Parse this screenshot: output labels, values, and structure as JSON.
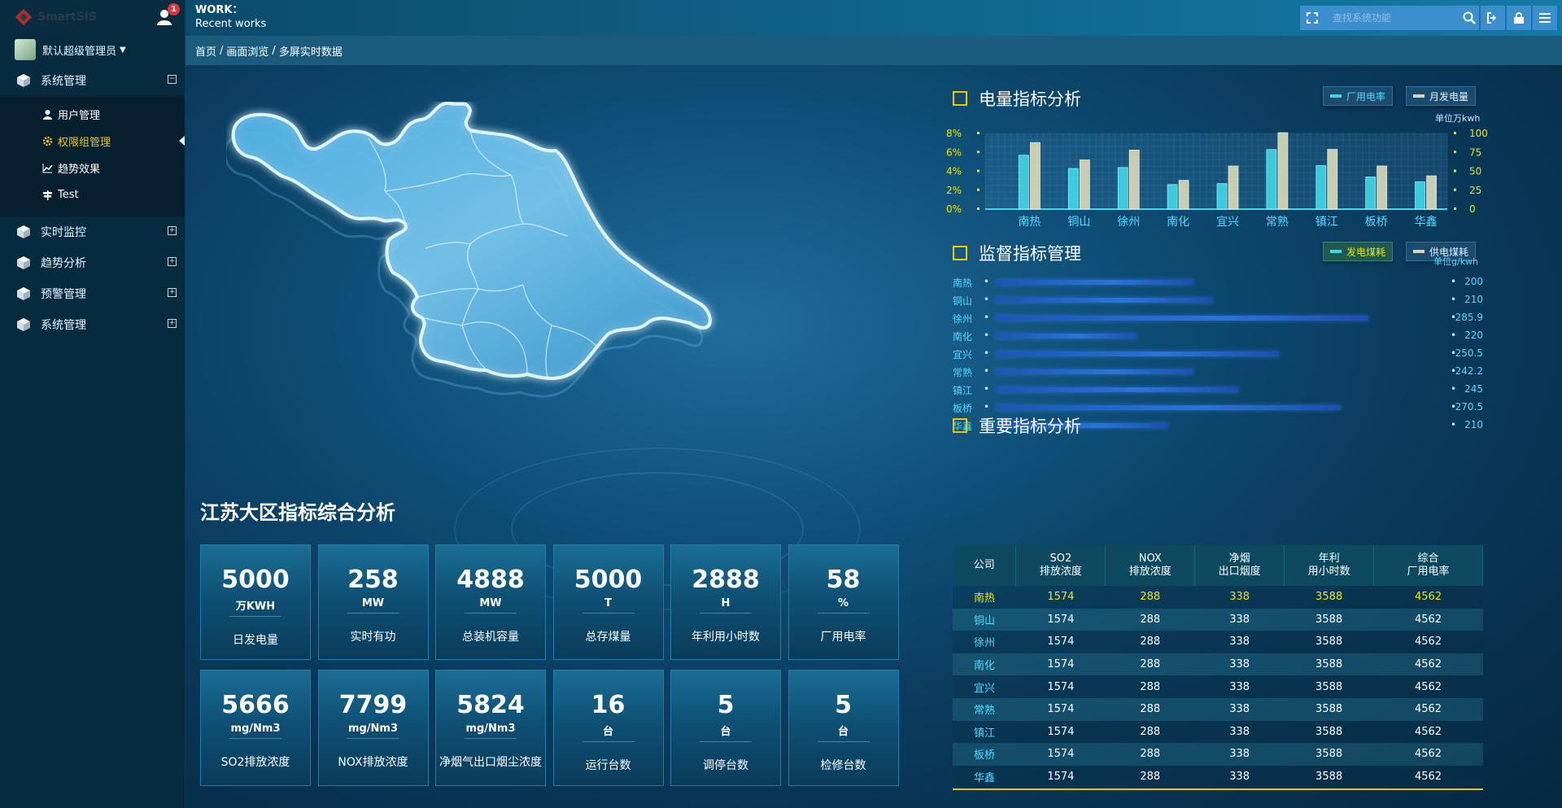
{
  "app": {
    "logo_text": "SmartSIS",
    "notif_count": "1",
    "user_name": "默认超级管理员"
  },
  "header": {
    "title": "WORK：",
    "subtitle": "Recent works",
    "search_placeholder": "查找系统功能"
  },
  "breadcrumb": [
    "首页",
    "画面浏览",
    "多屏实时数据"
  ],
  "sidebar": {
    "groups": [
      {
        "label": "系统管理",
        "expanded": true
      },
      {
        "label": "实时监控",
        "expanded": false
      },
      {
        "label": "趋势分析",
        "expanded": false
      },
      {
        "label": "预警管理",
        "expanded": false
      },
      {
        "label": "系统管理",
        "expanded": false
      }
    ],
    "subitems": [
      {
        "label": "用户管理",
        "icon": "user-icon"
      },
      {
        "label": "权限组管理",
        "icon": "gear-icon",
        "active": true
      },
      {
        "label": "趋势效果",
        "icon": "line-chart-icon"
      },
      {
        "label": "Test",
        "icon": "signpost-icon"
      }
    ]
  },
  "colors": {
    "accent_yellow": "#f2c400",
    "cyan": "#57d9ff",
    "bar_cyan": "#3fd8e8",
    "bar_beige": "#d8d8b8",
    "hbar_blue": "#2a6fd6"
  },
  "panel1": {
    "title": "电量指标分析",
    "legend": [
      "厂用电率",
      "月发电量"
    ],
    "unit": "单位万kwh",
    "chart_data": {
      "type": "bar",
      "categories": [
        "南热",
        "铜山",
        "徐州",
        "南化",
        "宜兴",
        "常熟",
        "镇江",
        "板桥",
        "华鑫"
      ],
      "series": [
        {
          "name": "厂用电率",
          "axis": "left",
          "values": [
            5.7,
            4.3,
            4.4,
            2.6,
            2.7,
            6.3,
            4.6,
            3.4,
            2.9
          ]
        },
        {
          "name": "月发电量",
          "axis": "right",
          "values": [
            88,
            65,
            78,
            38,
            57,
            101,
            79,
            57,
            44
          ]
        }
      ],
      "y_left": {
        "ticks": [
          "8%",
          "6%",
          "4%",
          "2%",
          "0%"
        ],
        "range": [
          0,
          8
        ]
      },
      "y_right": {
        "ticks": [
          "100",
          "75",
          "50",
          "25",
          "0"
        ],
        "range": [
          0,
          100
        ]
      }
    }
  },
  "panel2": {
    "title": "监督指标管理",
    "legend": [
      "发电煤耗",
      "供电煤耗"
    ],
    "unit": "单位g/kwh",
    "chart_data": {
      "type": "bar",
      "orientation": "horizontal",
      "categories": [
        "南热",
        "铜山",
        "徐州",
        "南化",
        "宜兴",
        "常熟",
        "镇江",
        "板桥",
        "华鑫"
      ],
      "values": [
        200,
        210,
        285.9,
        220,
        250.5,
        242.2,
        245,
        270.5,
        210
      ],
      "labels": [
        "200",
        "210",
        "285.9",
        "220",
        "250.5",
        "242.2",
        "245",
        "270.5",
        "210"
      ],
      "bar_fraction": [
        0.53,
        0.58,
        1.0,
        0.38,
        0.76,
        0.53,
        0.65,
        0.925,
        0.46
      ]
    }
  },
  "panel3": {
    "title": "重要指标分析",
    "columns": [
      [
        "公司"
      ],
      [
        "SO2",
        "排放浓度"
      ],
      [
        "NOX",
        "排放浓度"
      ],
      [
        "净烟",
        "出口烟度"
      ],
      [
        "年利",
        "用小时数"
      ],
      [
        "综合",
        "厂用电率"
      ]
    ],
    "rows": [
      [
        "南热",
        "1574",
        "288",
        "338",
        "3588",
        "4562"
      ],
      [
        "铜山",
        "1574",
        "288",
        "338",
        "3588",
        "4562"
      ],
      [
        "徐州",
        "1574",
        "288",
        "338",
        "3588",
        "4562"
      ],
      [
        "南化",
        "1574",
        "288",
        "338",
        "3588",
        "4562"
      ],
      [
        "宜兴",
        "1574",
        "288",
        "338",
        "3588",
        "4562"
      ],
      [
        "常熟",
        "1574",
        "288",
        "338",
        "3588",
        "4562"
      ],
      [
        "镇江",
        "1574",
        "288",
        "338",
        "3588",
        "4562"
      ],
      [
        "板桥",
        "1574",
        "288",
        "338",
        "3588",
        "4562"
      ],
      [
        "华鑫",
        "1574",
        "288",
        "338",
        "3588",
        "4562"
      ]
    ]
  },
  "kpi": {
    "title": "江苏大区指标综合分析",
    "items": [
      {
        "value": "5000",
        "unit": "万KWH",
        "label": "日发电量"
      },
      {
        "value": "258",
        "unit": "MW",
        "label": "实时有功"
      },
      {
        "value": "4888",
        "unit": "MW",
        "label": "总装机容量"
      },
      {
        "value": "5000",
        "unit": "T",
        "label": "总存煤量"
      },
      {
        "value": "2888",
        "unit": "H",
        "label": "年利用小时数"
      },
      {
        "value": "58",
        "unit": "%",
        "label": "厂用电率"
      },
      {
        "value": "5666",
        "unit": "mg/Nm3",
        "label": "SO2排放浓度"
      },
      {
        "value": "7799",
        "unit": "mg/Nm3",
        "label": "NOX排放浓度"
      },
      {
        "value": "5824",
        "unit": "mg/Nm3",
        "label": "净烟气出口烟尘浓度"
      },
      {
        "value": "16",
        "unit": "台",
        "label": "运行台数"
      },
      {
        "value": "5",
        "unit": "台",
        "label": "调停台数"
      },
      {
        "value": "5",
        "unit": "台",
        "label": "检修台数"
      }
    ]
  }
}
